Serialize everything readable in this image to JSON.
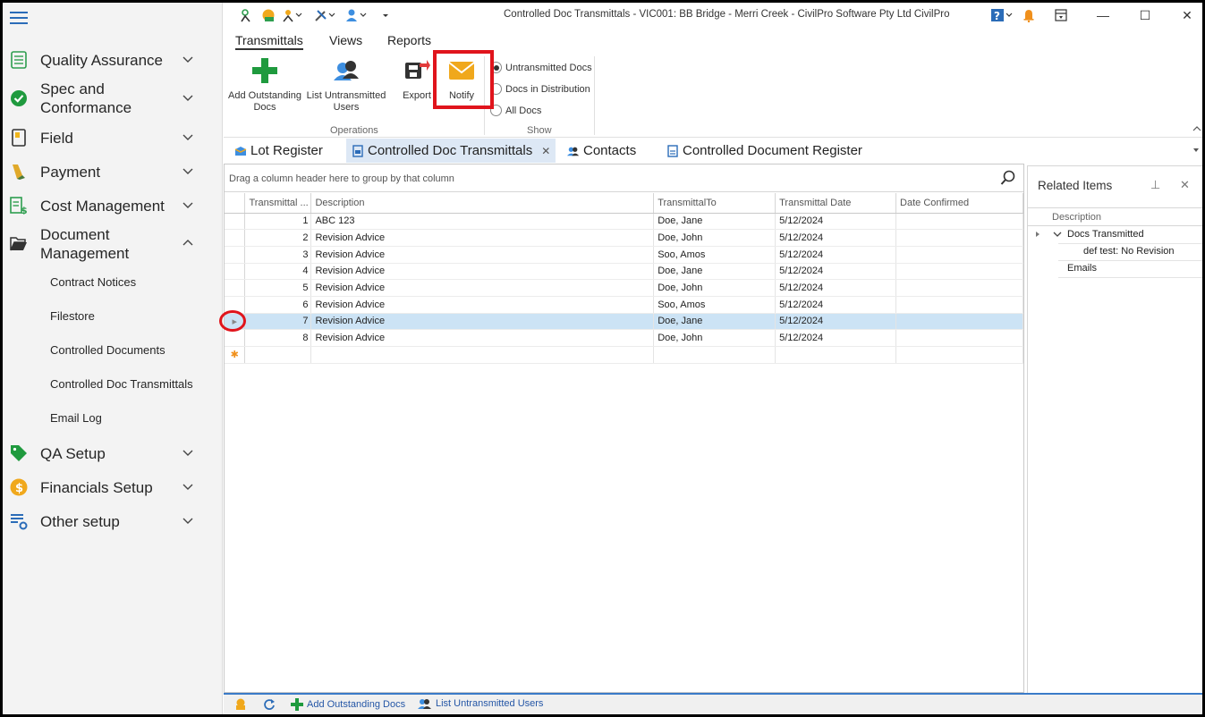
{
  "window": {
    "title": "Controlled Doc Transmittals - VIC001: BB Bridge -  Merri Creek  - CivilPro Software Pty Ltd CivilPro",
    "minimize": "—",
    "maximize": "☐",
    "close": "✕"
  },
  "sidebar": {
    "items": [
      {
        "label": "Quality Assurance",
        "icon": "checklist-icon"
      },
      {
        "label": "Spec and Conformance",
        "icon": "check-circle-icon"
      },
      {
        "label": "Field",
        "icon": "field-book-icon"
      },
      {
        "label": "Payment",
        "icon": "payment-icon"
      },
      {
        "label": "Cost Management",
        "icon": "cost-sheet-icon"
      },
      {
        "label": "Document Management",
        "icon": "folder-open-icon"
      },
      {
        "label": "QA Setup",
        "icon": "tag-icon"
      },
      {
        "label": "Financials Setup",
        "icon": "dollar-coin-icon"
      },
      {
        "label": "Other setup",
        "icon": "settings-list-icon"
      }
    ],
    "sub_items": [
      "Contract Notices",
      "Filestore",
      "Controlled Documents",
      "Controlled Doc Transmittals",
      "Email Log"
    ]
  },
  "ribbon": {
    "tabs": [
      "Transmittals",
      "Views",
      "Reports"
    ],
    "buttons": {
      "add_outstanding": "Add Outstanding Docs",
      "list_untransmitted": "List Untransmitted Users",
      "export": "Export",
      "notify": "Notify"
    },
    "groups": {
      "operations": "Operations",
      "show": "Show"
    },
    "show_options": [
      "Untransmitted Docs",
      "Docs in Distribution",
      "All Docs"
    ],
    "show_selected": 0
  },
  "doc_tabs": [
    "Lot Register",
    "Controlled Doc Transmittals",
    "Contacts",
    "Controlled Document Register"
  ],
  "grid": {
    "group_panel_text": "Drag a column header here to group by that column",
    "columns": [
      "Transmittal ...",
      "Description",
      "TransmittalTo",
      "Transmittal Date",
      "Date Confirmed"
    ],
    "rows": [
      {
        "no": "1",
        "description": "ABC 123",
        "to": "Doe, Jane",
        "date": "5/12/2024",
        "confirmed": ""
      },
      {
        "no": "2",
        "description": "Revision Advice",
        "to": "Doe, John",
        "date": "5/12/2024",
        "confirmed": ""
      },
      {
        "no": "3",
        "description": "Revision Advice",
        "to": "Soo, Amos",
        "date": "5/12/2024",
        "confirmed": ""
      },
      {
        "no": "4",
        "description": "Revision Advice",
        "to": "Doe, Jane",
        "date": "5/12/2024",
        "confirmed": ""
      },
      {
        "no": "5",
        "description": "Revision Advice",
        "to": "Doe, John",
        "date": "5/12/2024",
        "confirmed": ""
      },
      {
        "no": "6",
        "description": "Revision Advice",
        "to": "Soo, Amos",
        "date": "5/12/2024",
        "confirmed": ""
      },
      {
        "no": "7",
        "description": "Revision Advice",
        "to": "Doe, Jane",
        "date": "5/12/2024",
        "confirmed": ""
      },
      {
        "no": "8",
        "description": "Revision Advice",
        "to": "Doe, John",
        "date": "5/12/2024",
        "confirmed": ""
      }
    ],
    "selected_row": 6
  },
  "related": {
    "title": "Related Items",
    "column": "Description",
    "tree": {
      "docs_transmitted": "Docs Transmitted",
      "child": "def test: No Revision",
      "emails": "Emails"
    }
  },
  "statusbar": {
    "add_outstanding": "Add Outstanding Docs",
    "list_untransmitted": "List Untransmitted Users"
  },
  "colors": {
    "accent": "#2b6cb8",
    "highlight": "#e0141c",
    "selected_row": "#cce3f5"
  }
}
